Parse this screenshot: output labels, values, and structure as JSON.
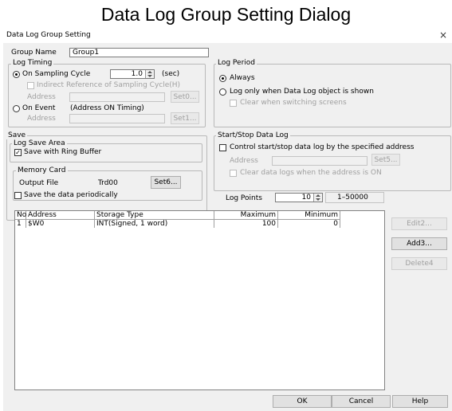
{
  "caption": "Data Log Group Setting Dialog",
  "window": {
    "title": "Data Log Group Setting",
    "close_glyph": "×"
  },
  "group_name": {
    "label": "Group Name",
    "value": "Group1"
  },
  "log_timing": {
    "legend": "Log Timing",
    "sampling_label": "On Sampling Cycle",
    "sampling_value": "1.0",
    "sampling_unit": "(sec)",
    "indirect_label": "Indirect Reference of Sampling Cycle(H)",
    "address_label": "Address",
    "set_button": "Set0...",
    "event_label": "On Event",
    "event_hint": "(Address ON Timing)",
    "address_label2": "Address",
    "set_button2": "Set1..."
  },
  "save": {
    "legend": "Save",
    "log_save_area": "Log Save Area",
    "ring_buffer_label": "Save with Ring Buffer",
    "ring_buffer_checked": true,
    "memory_card_legend": "Memory Card",
    "output_file_label": "Output File",
    "output_file_value": "Trd00",
    "set_button": "Set6...",
    "periodic_label": "Save the data periodically"
  },
  "log_period": {
    "legend": "Log Period",
    "always_label": "Always",
    "shown_label": "Log only when Data Log object is shown",
    "clear_label": "Clear when switching screens"
  },
  "start_stop": {
    "legend": "Start/Stop Data Log",
    "control_label": "Control start/stop data log by the specified address",
    "address_label": "Address",
    "set_button": "Set5...",
    "clear_label": "Clear data logs when the address is ON"
  },
  "log_points": {
    "label": "Log Points",
    "value": "10",
    "range": "1–50000"
  },
  "table": {
    "columns": [
      "No.",
      "Address",
      "Storage Type",
      "Maximum",
      "Minimum"
    ],
    "rows": [
      {
        "no": "1",
        "address": "$W0",
        "type": "INT(Signed, 1 word)",
        "max": "100",
        "min": "0"
      }
    ]
  },
  "side_buttons": {
    "edit": "Edit2...",
    "add": "Add3...",
    "delete": "Delete4"
  },
  "footer_buttons": {
    "ok": "OK",
    "cancel": "Cancel",
    "help": "Help"
  }
}
